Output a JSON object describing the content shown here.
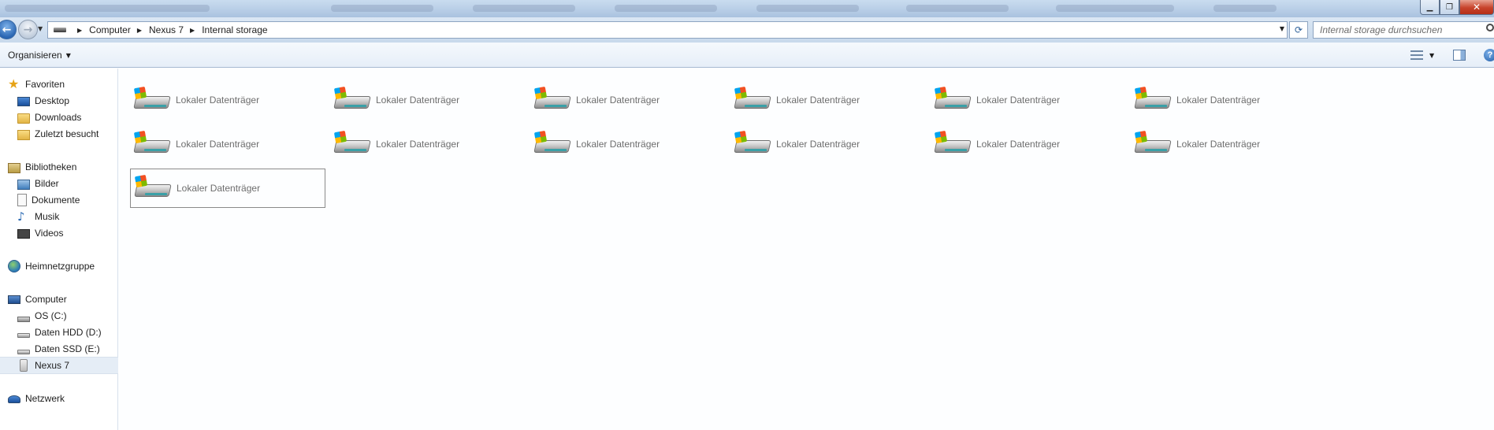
{
  "window": {
    "minimize_glyph": "▁",
    "maximize_glyph": "❐",
    "close_glyph": "✕"
  },
  "address_bar": {
    "crumbs": [
      "Computer",
      "Nexus 7",
      "Internal storage"
    ],
    "separator": "▶",
    "dropdown_glyph": "▼",
    "refresh_glyph": "⟳"
  },
  "search": {
    "placeholder": "Internal storage durchsuchen"
  },
  "command_bar": {
    "organize_label": "Organisieren",
    "organize_arrow": "▼",
    "view_arrow": "▼",
    "help_glyph": "?"
  },
  "nav_pane": {
    "favorites": {
      "label": "Favoriten",
      "items": [
        "Desktop",
        "Downloads",
        "Zuletzt besucht"
      ]
    },
    "libraries": {
      "label": "Bibliotheken",
      "items": [
        "Bilder",
        "Dokumente",
        "Musik",
        "Videos"
      ]
    },
    "homegroup": {
      "label": "Heimnetzgruppe"
    },
    "computer": {
      "label": "Computer",
      "items": [
        "OS (C:)",
        "Daten HDD (D:)",
        "Daten SSD (E:)",
        "Nexus 7"
      ],
      "selected": "Nexus 7"
    },
    "network": {
      "label": "Netzwerk"
    }
  },
  "content": {
    "items": [
      "Lokaler Datenträger",
      "Lokaler Datenträger",
      "Lokaler Datenträger",
      "Lokaler Datenträger",
      "Lokaler Datenträger",
      "Lokaler Datenträger",
      "Lokaler Datenträger",
      "Lokaler Datenträger",
      "Lokaler Datenträger",
      "Lokaler Datenträger",
      "Lokaler Datenträger",
      "Lokaler Datenträger",
      "Lokaler Datenträger"
    ],
    "focused_index": 12
  },
  "colors": {
    "selection_bg": "#e5edf6",
    "item_label": "#6d6d6d",
    "close_button": "#c7432b"
  }
}
